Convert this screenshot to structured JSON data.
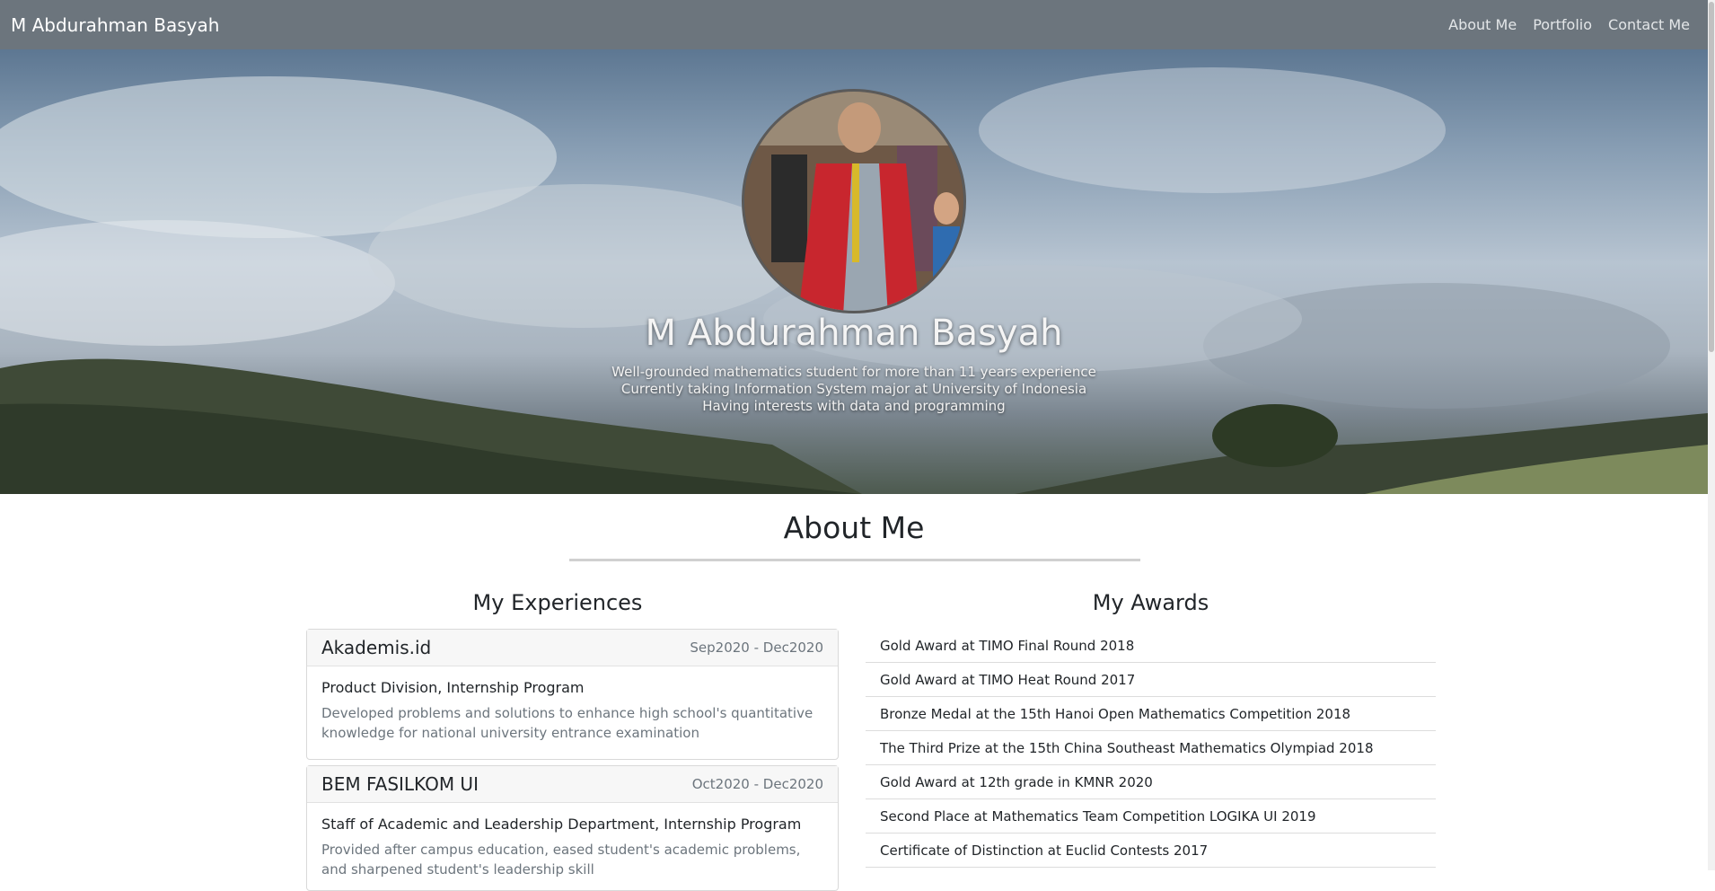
{
  "navbar": {
    "brand": "M Abdurahman Basyah",
    "links": [
      "About Me",
      "Portfolio",
      "Contact Me"
    ]
  },
  "hero": {
    "name": "M Abdurahman Basyah",
    "lines": [
      "Well-grounded mathematics student for more than 11 years experience",
      "Currently taking Information System major at University of Indonesia",
      "Having interests with data and programming"
    ]
  },
  "about": {
    "title": "About Me",
    "experiences_title": "My Experiences",
    "awards_title": "My Awards",
    "experiences": [
      {
        "org": "Akademis.id",
        "date": "Sep2020 - Dec2020",
        "role": "Product Division, Internship Program",
        "desc": "Developed problems and solutions to enhance high school's quantitative knowledge for national university entrance examination"
      },
      {
        "org": "BEM FASILKOM UI",
        "date": "Oct2020 - Dec2020",
        "role": "Staff of Academic and Leadership Department, Internship Program",
        "desc": "Provided after campus education, eased student's academic problems, and sharpened student's leadership skill"
      }
    ],
    "awards": [
      "Gold Award at TIMO Final Round 2018",
      "Gold Award at TIMO Heat Round 2017",
      "Bronze Medal at the 15th Hanoi Open Mathematics Competition 2018",
      "The Third Prize at the 15th China Southeast Mathematics Olympiad 2018",
      "Gold Award at 12th grade in KMNR 2020",
      "Second Place at Mathematics Team Competition LOGIKA UI 2019",
      "Certificate of Distinction at Euclid Contests 2017"
    ]
  }
}
